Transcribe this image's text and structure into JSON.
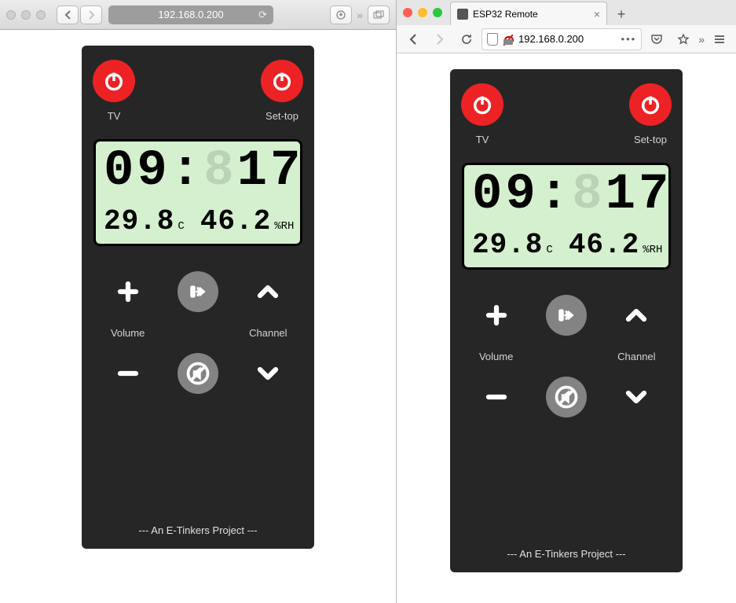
{
  "safari": {
    "url": "192.168.0.200"
  },
  "firefox": {
    "tab_title": "ESP32 Remote",
    "url": "192.168.0.200"
  },
  "app": {
    "power": {
      "tv": "TV",
      "settop": "Set-top"
    },
    "clock": {
      "hh": "09",
      "mm": "17"
    },
    "temperature": {
      "value": "29.8",
      "unit": "C"
    },
    "humidity": {
      "value": "46.2",
      "unit": "%RH"
    },
    "labels": {
      "volume": "Volume",
      "channel": "Channel"
    },
    "footer": "--- An E-Tinkers Project ---"
  }
}
